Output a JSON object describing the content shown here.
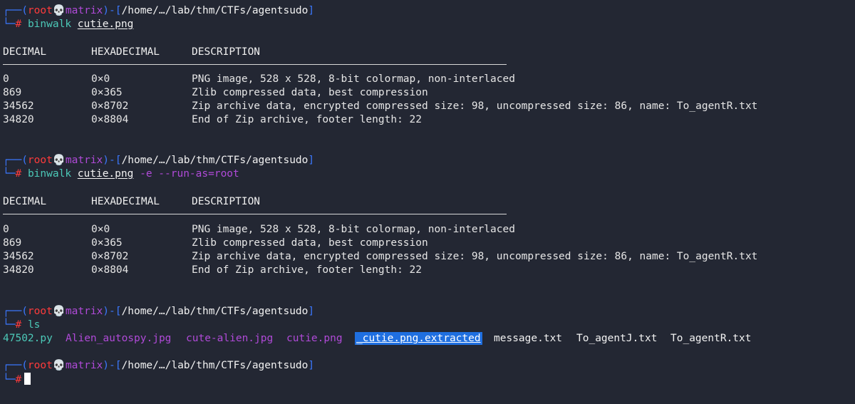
{
  "prompt": {
    "user": "root",
    "host": "matrix",
    "skull": "💀",
    "path": "/home/…/lab/thm/CTFs/agentsudo",
    "symbol": "#"
  },
  "commands": [
    {
      "cmd": "binwalk",
      "arg": "cutie.png",
      "flags": ""
    },
    {
      "cmd": "binwalk",
      "arg": "cutie.png",
      "flags": " -e --run-as=root"
    },
    {
      "cmd": "ls",
      "arg": "",
      "flags": ""
    }
  ],
  "table": {
    "headers": [
      "DECIMAL",
      "HEXADECIMAL",
      "DESCRIPTION"
    ],
    "rows": [
      [
        "0",
        "0×0",
        "PNG image, 528 x 528, 8-bit colormap, non-interlaced"
      ],
      [
        "869",
        "0×365",
        "Zlib compressed data, best compression"
      ],
      [
        "34562",
        "0×8702",
        "Zip archive data, encrypted compressed size: 98, uncompressed size: 86, name: To_agentR.txt"
      ],
      [
        "34820",
        "0×8804",
        "End of Zip archive, footer length: 22"
      ]
    ]
  },
  "ls_output": [
    {
      "name": "47502.py",
      "color": "#4cc9b8"
    },
    {
      "name": "Alien_autospy.jpg",
      "color": "#b04ad8"
    },
    {
      "name": "cute-alien.jpg",
      "color": "#b04ad8"
    },
    {
      "name": "cutie.png",
      "color": "#b04ad8"
    },
    {
      "name": "_cutie.png.extracted",
      "color": "#ffffff"
    },
    {
      "name": "message.txt",
      "color": "#f2f2f2"
    },
    {
      "name": "To_agentJ.txt",
      "color": "#f2f2f2"
    },
    {
      "name": "To_agentR.txt",
      "color": "#f2f2f2"
    }
  ],
  "colors": {
    "background": "#232733",
    "prompt_frame": "#3b78ff",
    "user": "#ff3b3b",
    "host": "#b04ad8",
    "command": "#4cc9b8",
    "highlight": "#1f6fe0"
  }
}
